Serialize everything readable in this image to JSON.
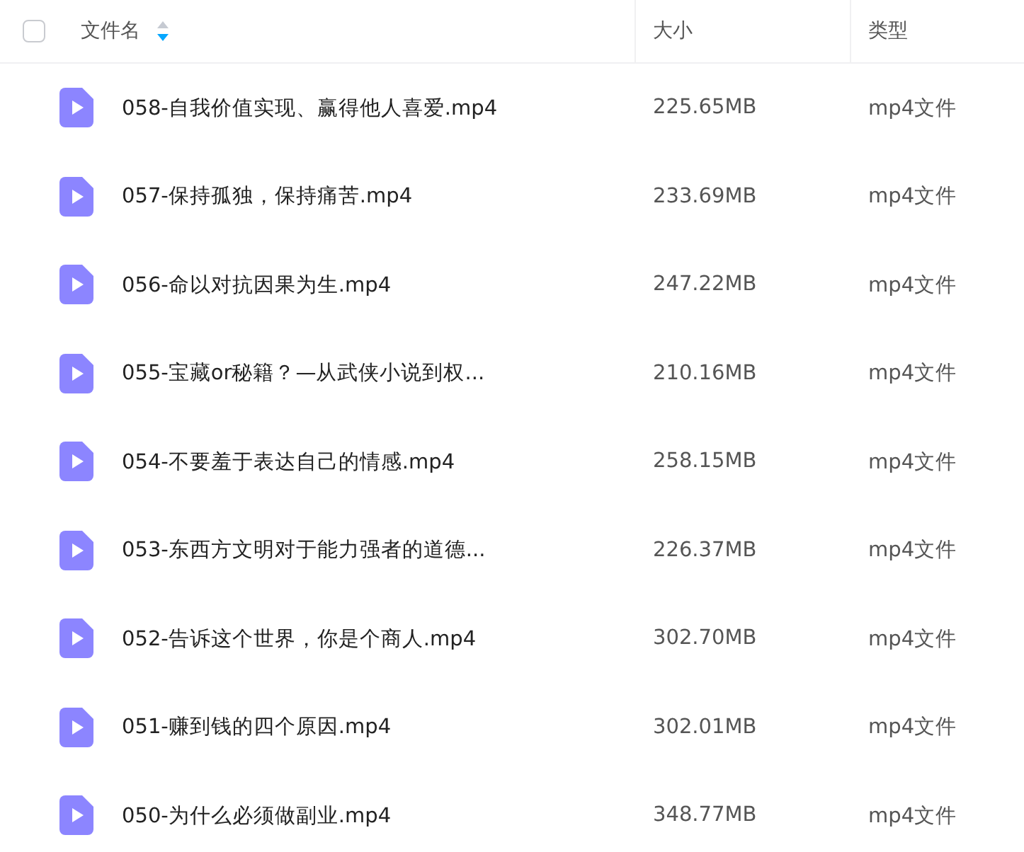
{
  "header": {
    "select_all": {
      "checked": false
    },
    "columns": [
      {
        "label": "文件名",
        "sorted_descending": true
      },
      {
        "label": "大小"
      },
      {
        "label": "类型"
      }
    ]
  },
  "rows": [
    {
      "name": "058-自我价值实现、赢得他人喜爱.mp4",
      "size": "225.65MB",
      "type": "mp4文件"
    },
    {
      "name": "057-保持孤独，保持痛苦.mp4",
      "size": "233.69MB",
      "type": "mp4文件"
    },
    {
      "name": "056-命以对抗因果为生.mp4",
      "size": "247.22MB",
      "type": "mp4文件"
    },
    {
      "name": "055-宝藏or秘籍？—从武侠小说到权...",
      "size": "210.16MB",
      "type": "mp4文件"
    },
    {
      "name": "054-不要羞于表达自己的情感.mp4",
      "size": "258.15MB",
      "type": "mp4文件"
    },
    {
      "name": "053-东西方文明对于能力强者的道德...",
      "size": "226.37MB",
      "type": "mp4文件"
    },
    {
      "name": "052-告诉这个世界，你是个商人.mp4",
      "size": "302.70MB",
      "type": "mp4文件"
    },
    {
      "name": "051-赚到钱的四个原因.mp4",
      "size": "302.01MB",
      "type": "mp4文件"
    },
    {
      "name": "050-为什么必须做副业.mp4",
      "size": "348.77MB",
      "type": "mp4文件"
    }
  ]
}
